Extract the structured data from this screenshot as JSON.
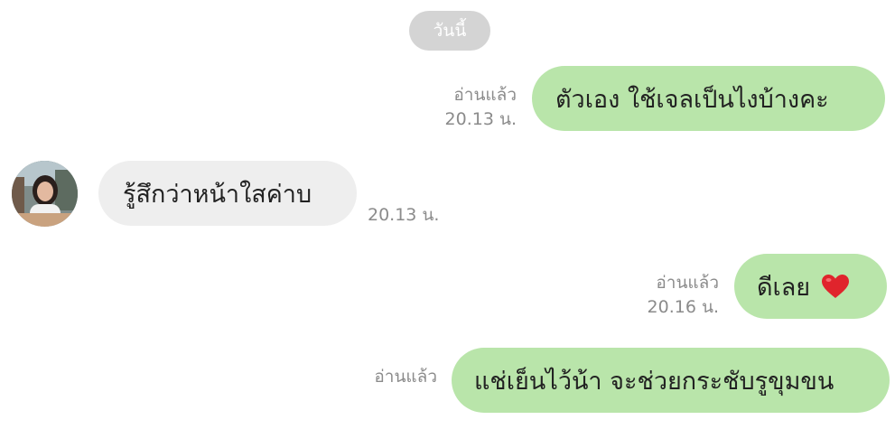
{
  "date_divider": "วันนี้",
  "messages": [
    {
      "text": "ตัวเอง ใช้เจลเป็นไงบ้างคะ",
      "read_label": "อ่านแล้ว",
      "time": "20.13 น."
    },
    {
      "text": "รู้สึกว่าหน้าใสค่าบ",
      "time": "20.13 น."
    },
    {
      "text": "ดีเลย",
      "emoji": "heart-icon",
      "read_label": "อ่านแล้ว",
      "time": "20.16 น."
    },
    {
      "text": "แช่เย็นไว้น้า จะช่วยกระชับรูขุมขน",
      "read_label": "อ่านแล้ว"
    }
  ],
  "colors": {
    "outgoing_bubble": "#b9e5aa",
    "incoming_bubble": "#eeeeee",
    "date_pill": "#d4d4d4",
    "meta_text": "#8b8b8b",
    "heart": "#e0242c"
  }
}
